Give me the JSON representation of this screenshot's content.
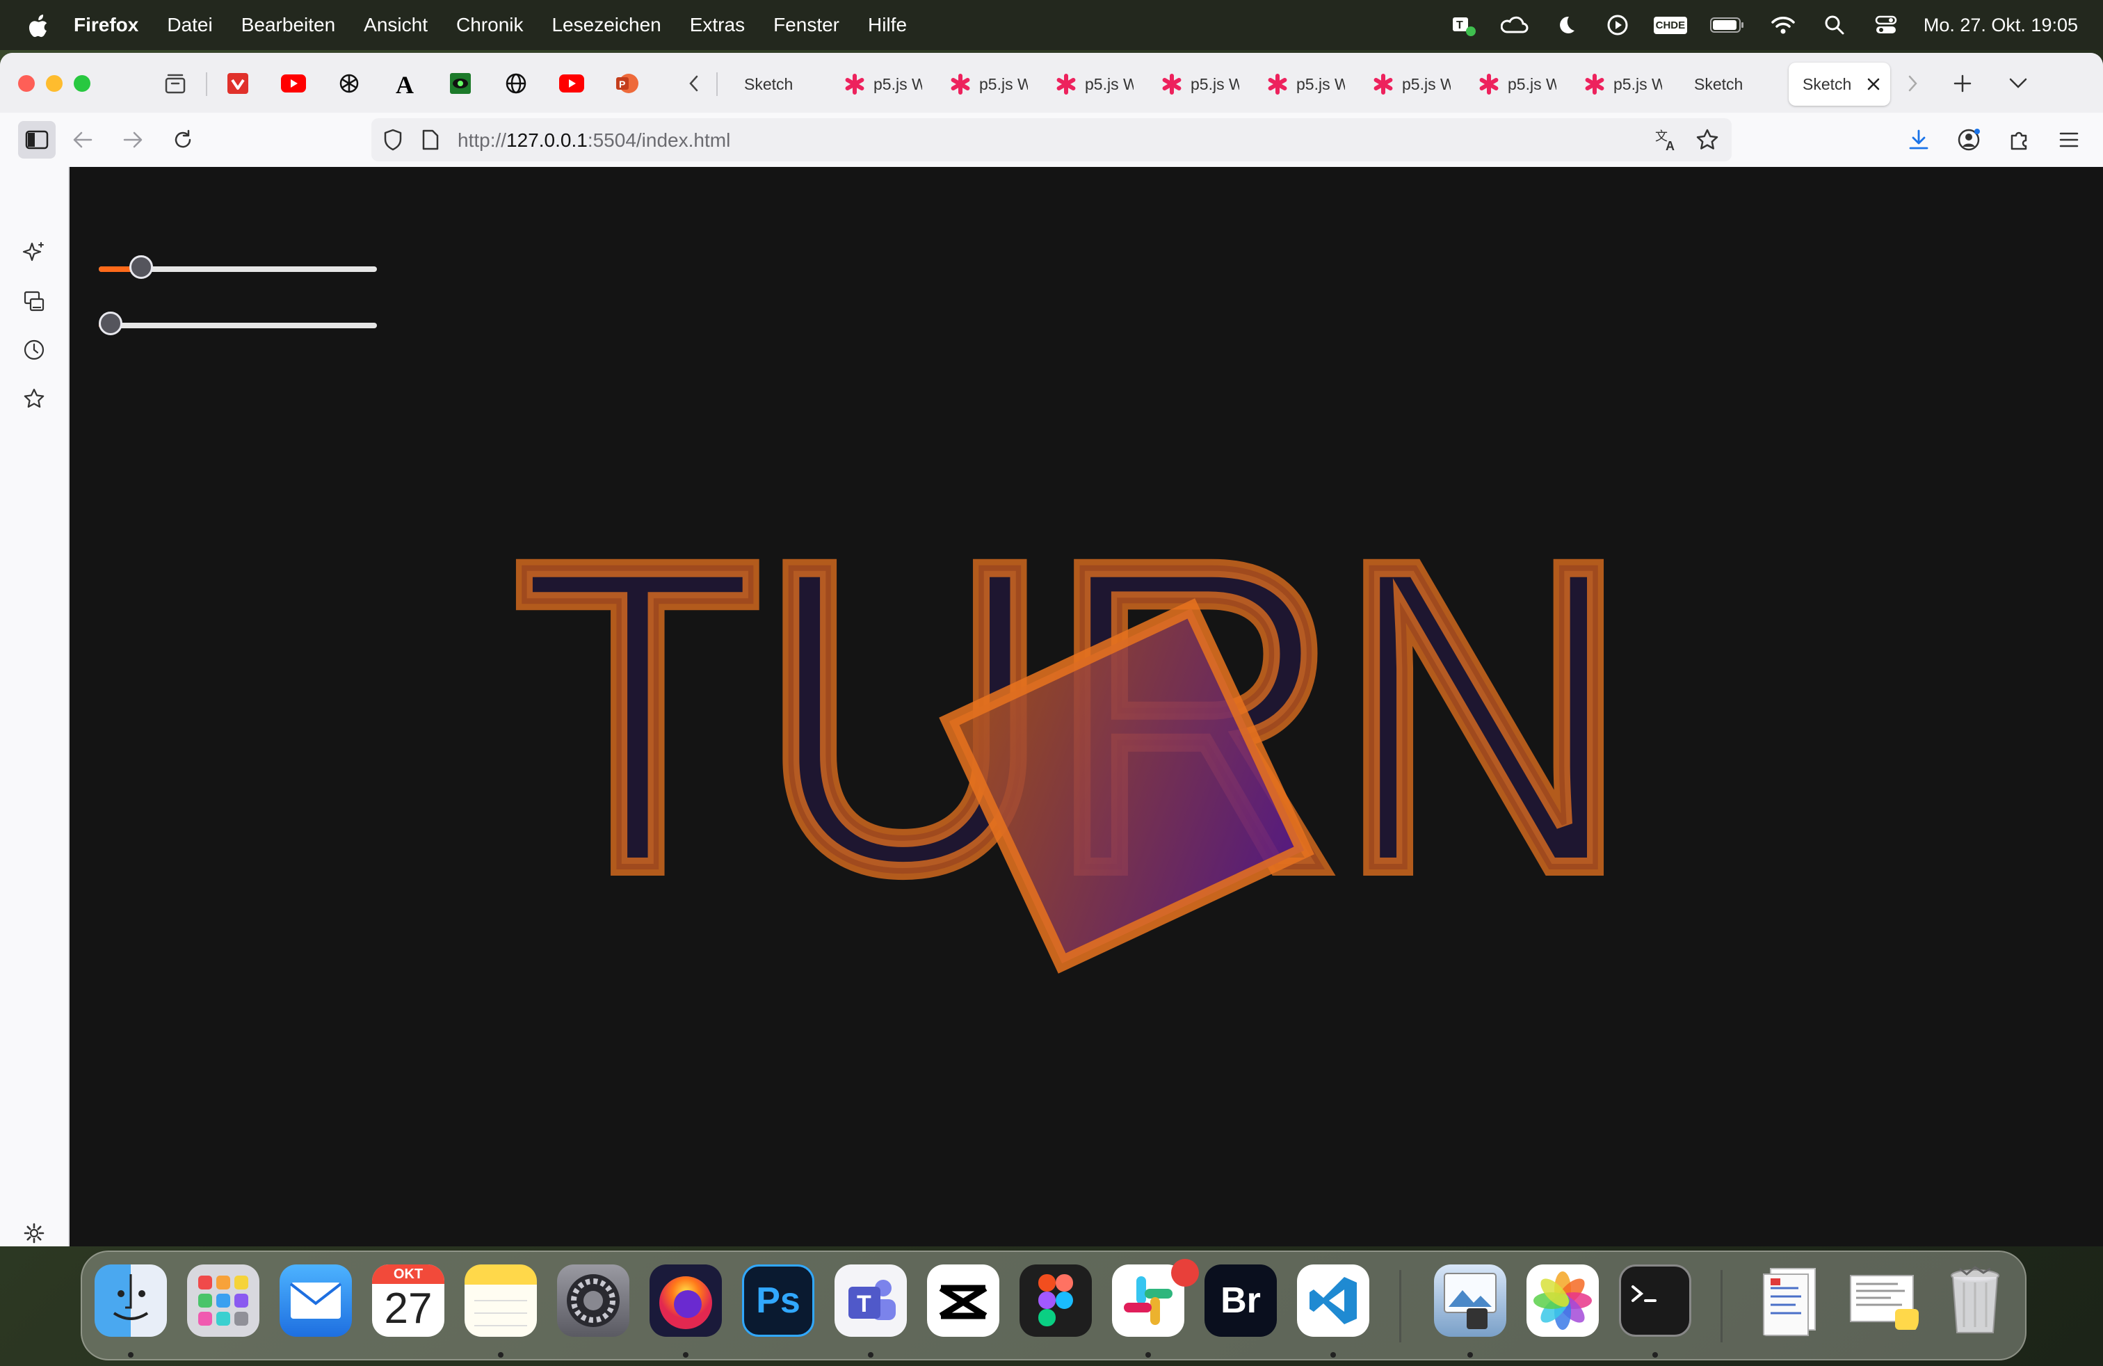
{
  "menubar": {
    "app": "Firefox",
    "items": [
      "Datei",
      "Bearbeiten",
      "Ansicht",
      "Chronik",
      "Lesezeichen",
      "Extras",
      "Fenster",
      "Hilfe"
    ],
    "clock": "Mo. 27. Okt.  19:05",
    "status_icons": [
      "teams-status-icon",
      "creative-cloud-icon",
      "focus-moon-icon",
      "play-icon",
      "keyboard-layout-chde-icon",
      "battery-icon",
      "wifi-icon",
      "spotlight-search-icon",
      "control-center-icon"
    ],
    "keyboard_badge": "CHDE"
  },
  "browser": {
    "pinned_tabs": [
      "vivaldi-icon",
      "youtube-icon",
      "openai-icon",
      "font-a-icon",
      "eye-app-icon",
      "globe-icon",
      "youtube-icon",
      "powerpoint-icon"
    ],
    "tabs": [
      {
        "label": "Sketch",
        "icon": "none"
      },
      {
        "label": "p5.js W",
        "icon": "p5js-asterisk-icon"
      },
      {
        "label": "p5.js W",
        "icon": "p5js-asterisk-icon"
      },
      {
        "label": "p5.js W",
        "icon": "p5js-asterisk-icon"
      },
      {
        "label": "p5.js W",
        "icon": "p5js-asterisk-icon"
      },
      {
        "label": "p5.js W",
        "icon": "p5js-asterisk-icon"
      },
      {
        "label": "p5.js W",
        "icon": "p5js-asterisk-icon"
      },
      {
        "label": "p5.js W",
        "icon": "p5js-asterisk-icon"
      },
      {
        "label": "p5.js W",
        "icon": "p5js-asterisk-icon"
      },
      {
        "label": "Sketch",
        "icon": "none"
      }
    ],
    "active_tab": {
      "label": "Sketch"
    },
    "url": {
      "scheme": "http://",
      "host": "127.0.0.1",
      "rest": ":5504/index.html"
    }
  },
  "sketch": {
    "word": "TURN",
    "slider1": {
      "value": 0.12
    },
    "slider2": {
      "value": 0.0
    },
    "colors": {
      "background": "#141414",
      "stroke": "#e8731f",
      "fill": "#1e1630",
      "accent": "#ff6a1a"
    }
  },
  "dock": {
    "apps": [
      "finder-icon",
      "launchpad-icon",
      "mail-icon",
      "calendar-icon",
      "notes-icon",
      "system-settings-icon",
      "firefox-icon",
      "photoshop-icon",
      "teams-icon",
      "capcut-icon",
      "figma-icon",
      "slack-icon",
      "bridge-icon",
      "vscode-icon",
      "preview-icon",
      "photos-icon",
      "terminal-icon",
      "documents-stack-icon",
      "downloads-stack-icon",
      "trash-icon"
    ],
    "calendar_month": "OKT",
    "calendar_day": "27",
    "photoshop_label": "Ps",
    "bridge_label": "Br"
  }
}
